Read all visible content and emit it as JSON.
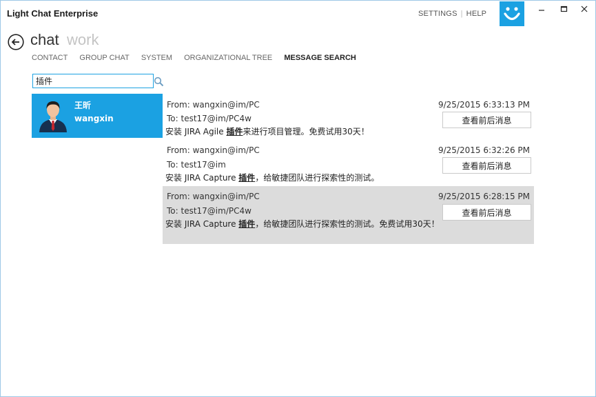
{
  "app": {
    "title": "Light Chat Enterprise"
  },
  "top_links": {
    "settings": "SETTINGS",
    "help": "HELP"
  },
  "modes": {
    "chat": "chat",
    "work": "work"
  },
  "nav": {
    "items": [
      "CONTACT",
      "GROUP CHAT",
      "SYSTEM",
      "ORGANIZATIONAL TREE",
      "MESSAGE SEARCH"
    ],
    "active": "MESSAGE SEARCH"
  },
  "search": {
    "value": "插件"
  },
  "contact": {
    "name": "王昕",
    "id": "wangxin"
  },
  "results": [
    {
      "from": "From: wangxin@im/PC",
      "to": "To: test17@im/PC4w",
      "time": "9/25/2015 6:33:13 PM",
      "content_pre": "安装 JIRA Agile ",
      "content_hit": "插件",
      "content_post": "来进行项目管理。免费试用30天！",
      "button": "查看前后消息"
    },
    {
      "from": "From: wangxin@im/PC",
      "to": "To: test17@im",
      "time": "9/25/2015 6:32:26 PM",
      "content_pre": "安装 JIRA Capture ",
      "content_hit": "插件",
      "content_post": "，给敏捷团队进行探索性的测试。",
      "button": "查看前后消息"
    },
    {
      "from": "From: wangxin@im/PC",
      "to": "To: test17@im/PC4w",
      "time": "9/25/2015 6:28:15 PM",
      "content_pre": "安装 JIRA Capture ",
      "content_hit": "插件",
      "content_post": "，给敏捷团队进行探索性的测试。免费试用30天！",
      "button": "查看前后消息"
    }
  ],
  "colors": {
    "accent": "#1ba1e2",
    "selected_row": "#dcdcdc"
  }
}
